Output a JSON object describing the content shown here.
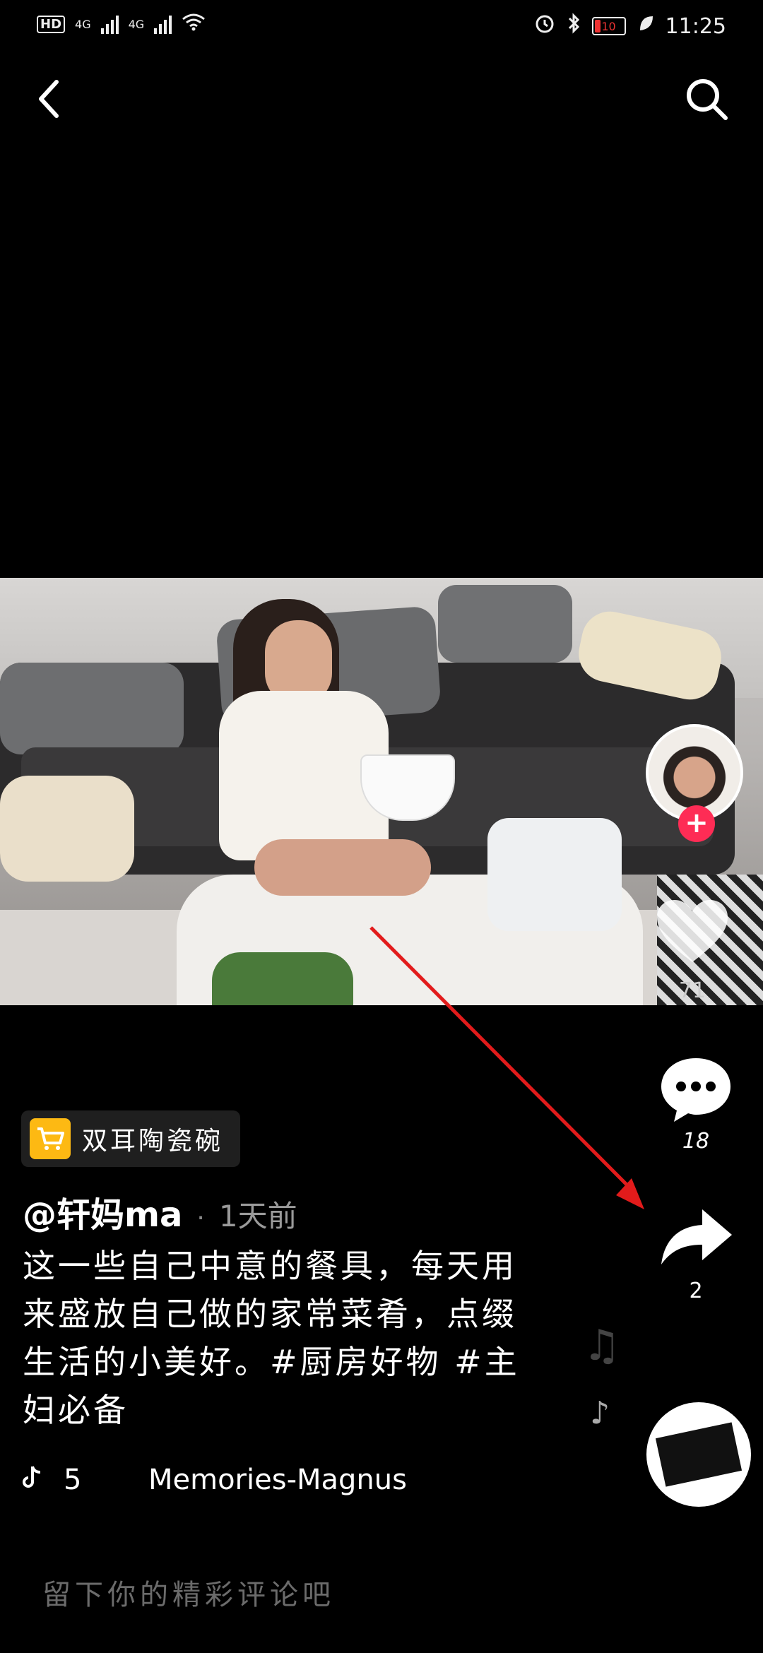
{
  "status_bar": {
    "left_text": "HD",
    "network1": "4G",
    "network2": "4G",
    "battery": "10",
    "time": "11:25"
  },
  "video": {
    "like_count": "71",
    "comment_count": "18",
    "share_count": "2"
  },
  "product": {
    "label": "双耳陶瓷碗"
  },
  "author": {
    "name": "@轩妈ma",
    "separator": "·",
    "time": "1天前"
  },
  "caption": "这一些自己中意的餐具，每天用来盛放自己做的家常菜肴，点缀生活的小美好。#厨房好物 #主妇必备",
  "music": {
    "count": "5",
    "name": "Memories-Magnus"
  },
  "comment_input": {
    "placeholder": "留下你的精彩评论吧"
  },
  "colors": {
    "accent": "#fe2c55",
    "cart": "#fdb913",
    "annotation_arrow": "#e21b1b"
  },
  "icons": [
    "back-arrow-icon",
    "search-icon",
    "heart-icon",
    "comment-icon",
    "share-icon",
    "music-note-icon",
    "cart-icon",
    "tiktok-icon"
  ]
}
